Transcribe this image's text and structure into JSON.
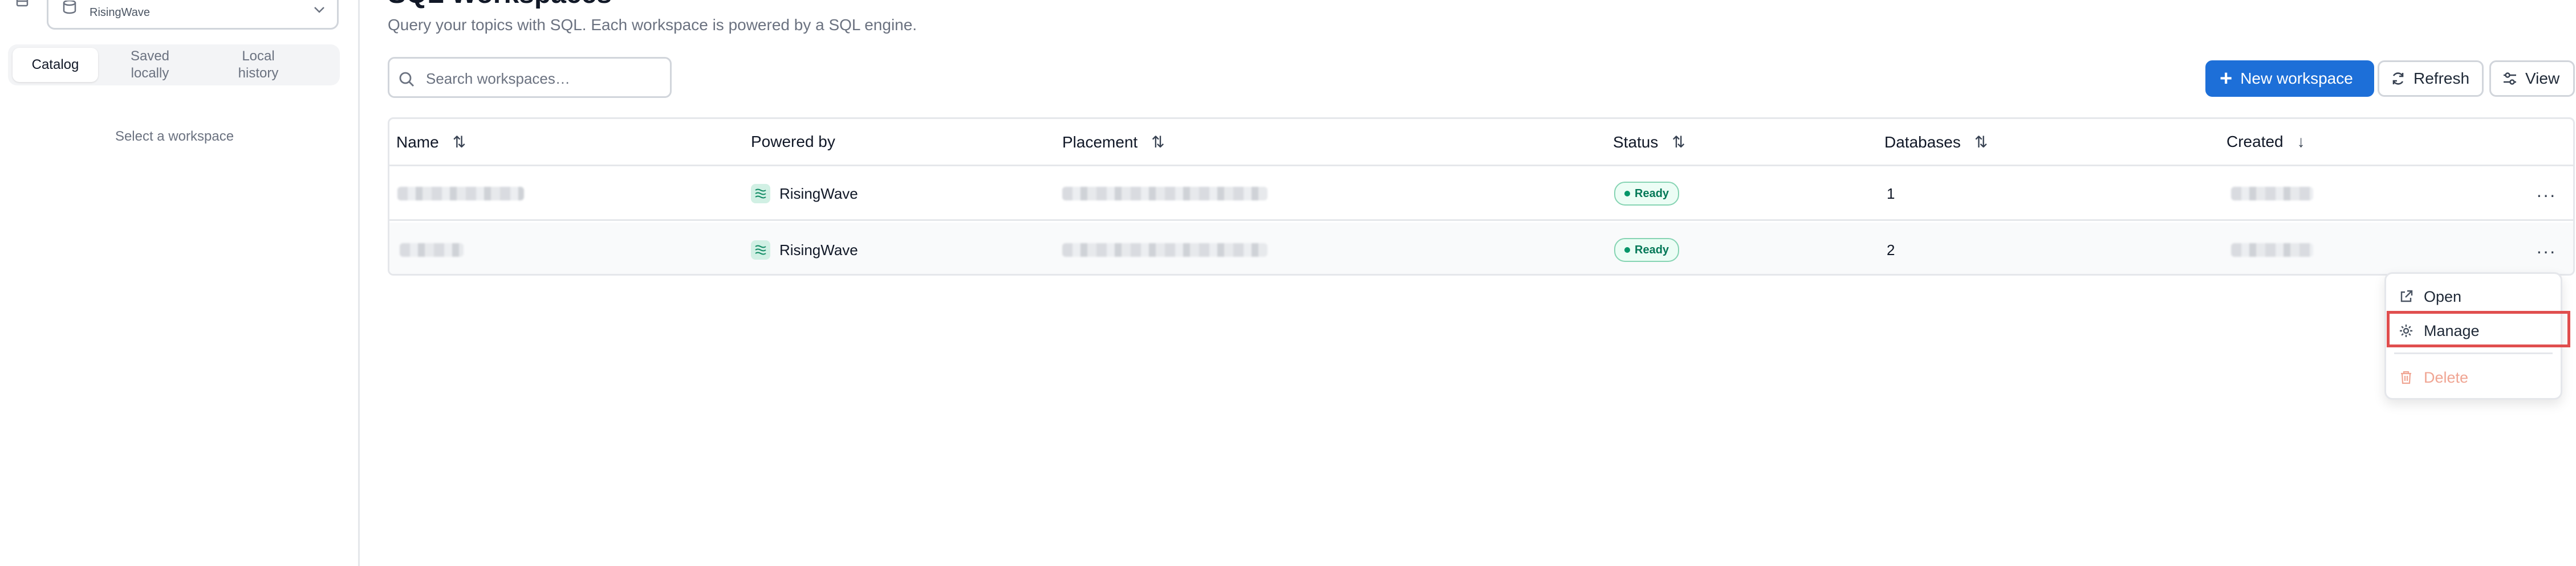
{
  "sidebar": {
    "engine_label": "RisingWave",
    "tabs": [
      {
        "label": "Catalog"
      },
      {
        "label": "Saved\nlocally"
      },
      {
        "label": "Local\nhistory"
      }
    ],
    "empty_text": "Select a workspace"
  },
  "header": {
    "title": "SQL Workspaces",
    "subtitle": "Query your topics with SQL. Each workspace is powered by a SQL engine."
  },
  "search": {
    "placeholder": "Search workspaces…",
    "value": ""
  },
  "toolbar": {
    "new_label": "New workspace",
    "refresh_label": "Refresh",
    "view_label": "View"
  },
  "table": {
    "columns": [
      {
        "label": "Name",
        "sort": "⇅"
      },
      {
        "label": "Powered by",
        "sort": ""
      },
      {
        "label": "Placement",
        "sort": "⇅"
      },
      {
        "label": "Status",
        "sort": "⇅"
      },
      {
        "label": "Databases",
        "sort": "⇅"
      },
      {
        "label": "Created",
        "sort": "↓"
      }
    ],
    "rows": [
      {
        "engine": "RisingWave",
        "status": "Ready",
        "databases": "1",
        "more": "···"
      },
      {
        "engine": "RisingWave",
        "status": "Ready",
        "databases": "2",
        "more": "···"
      }
    ]
  },
  "context_menu": {
    "items": [
      {
        "label": "Open",
        "icon": "external-link-icon"
      },
      {
        "label": "Manage",
        "icon": "gear-icon"
      },
      {
        "label": "Delete",
        "icon": "trash-icon"
      }
    ]
  },
  "colors": {
    "primary": "#1d6fd8",
    "status_ready": "#059669",
    "delete_text": "#f0a593",
    "highlight": "#e04e4e"
  }
}
